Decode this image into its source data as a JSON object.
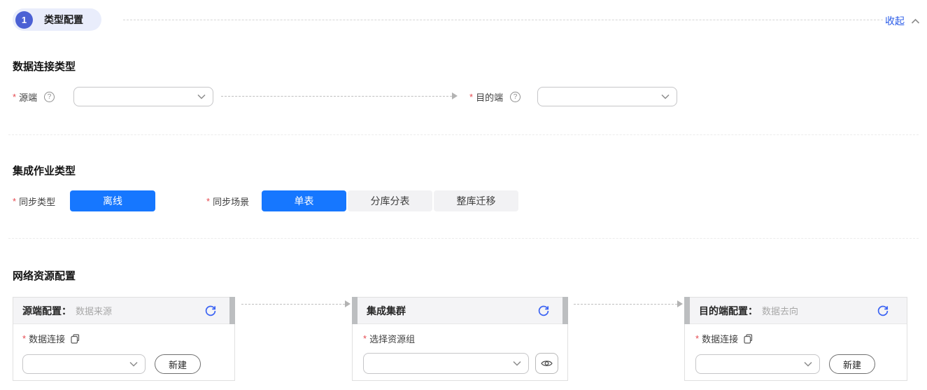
{
  "step": {
    "number": "1",
    "title": "类型配置",
    "collapse": "收起"
  },
  "icons": {
    "help": "?",
    "required_mark": "*"
  },
  "connection_section": {
    "heading": "数据连接类型",
    "source_label": "源端",
    "source_value": "",
    "dest_label": "目的端",
    "dest_value": ""
  },
  "job_section": {
    "heading": "集成作业类型",
    "sync_type_label": "同步类型",
    "sync_type_options": [
      {
        "label": "离线",
        "selected": true
      }
    ],
    "sync_scene_label": "同步场景",
    "sync_scene_options": [
      {
        "label": "单表",
        "selected": true
      },
      {
        "label": "分库分表",
        "selected": false
      },
      {
        "label": "整库迁移",
        "selected": false
      }
    ]
  },
  "network_section": {
    "heading": "网络资源配置",
    "cards": [
      {
        "title": "源端配置：",
        "subtitle": "数据来源",
        "field_label": "数据连接",
        "select_value": "",
        "action": "新建"
      },
      {
        "title": "集成集群",
        "subtitle": "",
        "field_label": "选择资源组",
        "select_value": ""
      },
      {
        "title": "目的端配置：",
        "subtitle": "数据去向",
        "field_label": "数据连接",
        "select_value": "",
        "action": "新建"
      }
    ]
  },
  "colors": {
    "primary_button": "#1677ff",
    "step_badge": "#4b61d4",
    "link": "#2b5ce8",
    "required_mark": "#e6494f",
    "card_port": "#bcbec0",
    "refresh_icon": "#3b63f3"
  }
}
